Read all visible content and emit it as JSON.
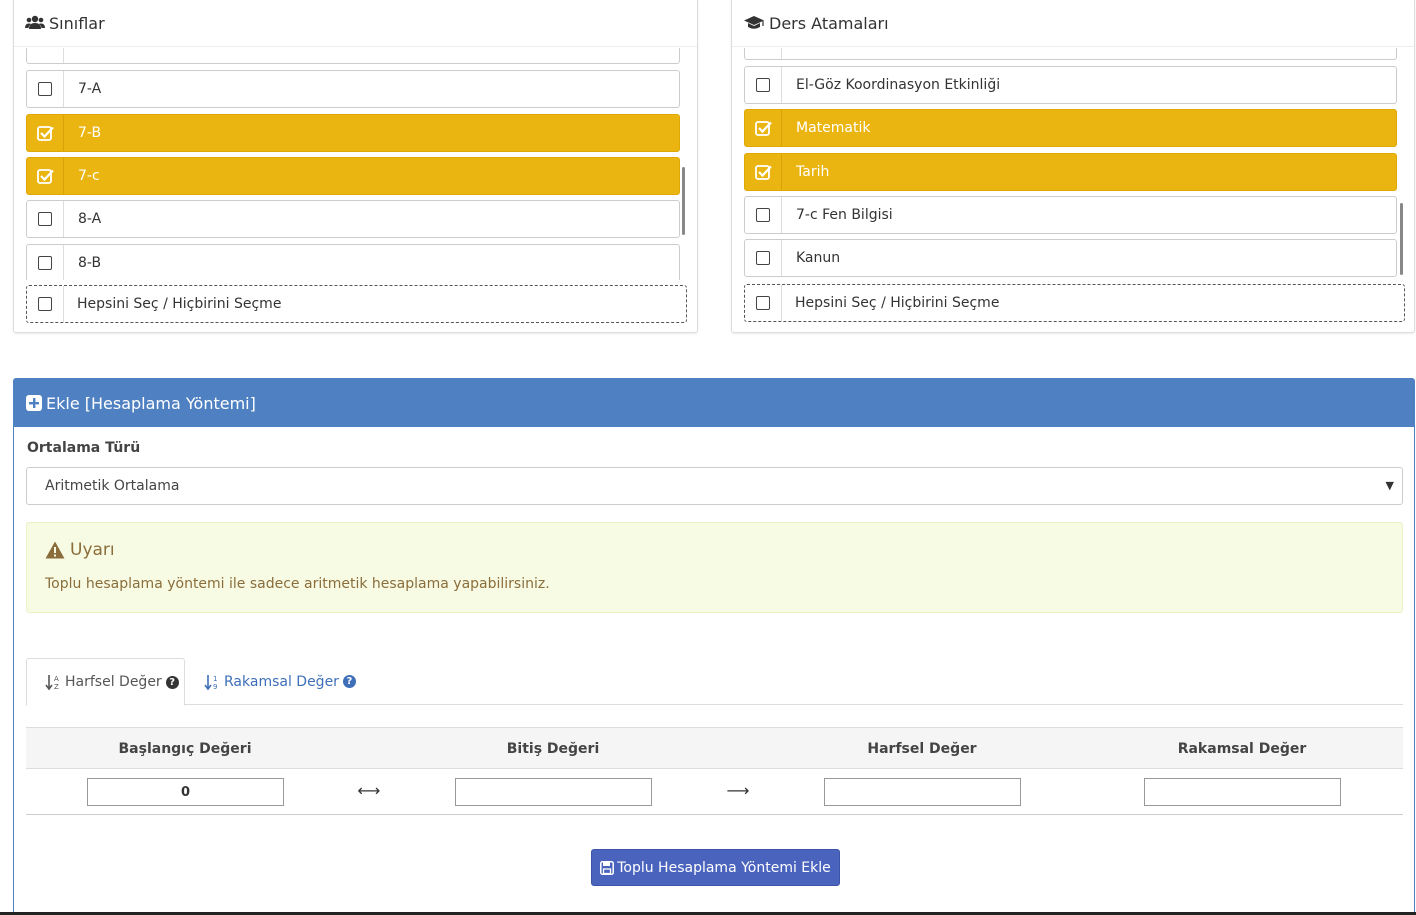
{
  "classes_panel": {
    "title": "Sınıflar",
    "icon": "users-icon",
    "items": [
      {
        "label": "7-A",
        "checked": false
      },
      {
        "label": "7-B",
        "checked": true
      },
      {
        "label": "7-c",
        "checked": true
      },
      {
        "label": "8-A",
        "checked": false
      },
      {
        "label": "8-B",
        "checked": false
      }
    ],
    "select_all_label": "Hepsini Seç / Hiçbirini Seçme"
  },
  "courses_panel": {
    "title": "Ders Atamaları",
    "icon": "graduation-cap-icon",
    "items": [
      {
        "label": "El-Göz Koordinasyon Etkinliği",
        "checked": false
      },
      {
        "label": "Matematik",
        "checked": true
      },
      {
        "label": "Tarih",
        "checked": true
      },
      {
        "label": "7-c Fen Bilgisi",
        "checked": false
      },
      {
        "label": "Kanun",
        "checked": false
      }
    ],
    "select_all_label": "Hepsini Seç / Hiçbirini Seçme"
  },
  "method_panel": {
    "title": "Ekle [Hesaplama Yöntemi]",
    "average_type_label": "Ortalama Türü",
    "average_type_value": "Aritmetik Ortalama",
    "warning": {
      "title": "Uyarı",
      "message": "Toplu hesaplama yöntemi ile sadece aritmetik hesaplama yapabilirsiniz."
    },
    "tabs": [
      {
        "label": "Harfsel Değer",
        "active": true
      },
      {
        "label": "Rakamsal Değer",
        "active": false
      }
    ],
    "table": {
      "headers": [
        "Başlangıç Değeri",
        "Bitiş Değeri",
        "Harfsel Değer",
        "Rakamsal Değer"
      ],
      "row": {
        "start": "0",
        "end": "",
        "letter": "",
        "number": ""
      }
    },
    "submit_label": "Toplu Hesaplama Yöntemi Ekle"
  },
  "colors": {
    "selected": "#ebb511",
    "primary": "#4f81c2",
    "button": "#4a63bd",
    "warning_bg": "#f8fbe3"
  }
}
